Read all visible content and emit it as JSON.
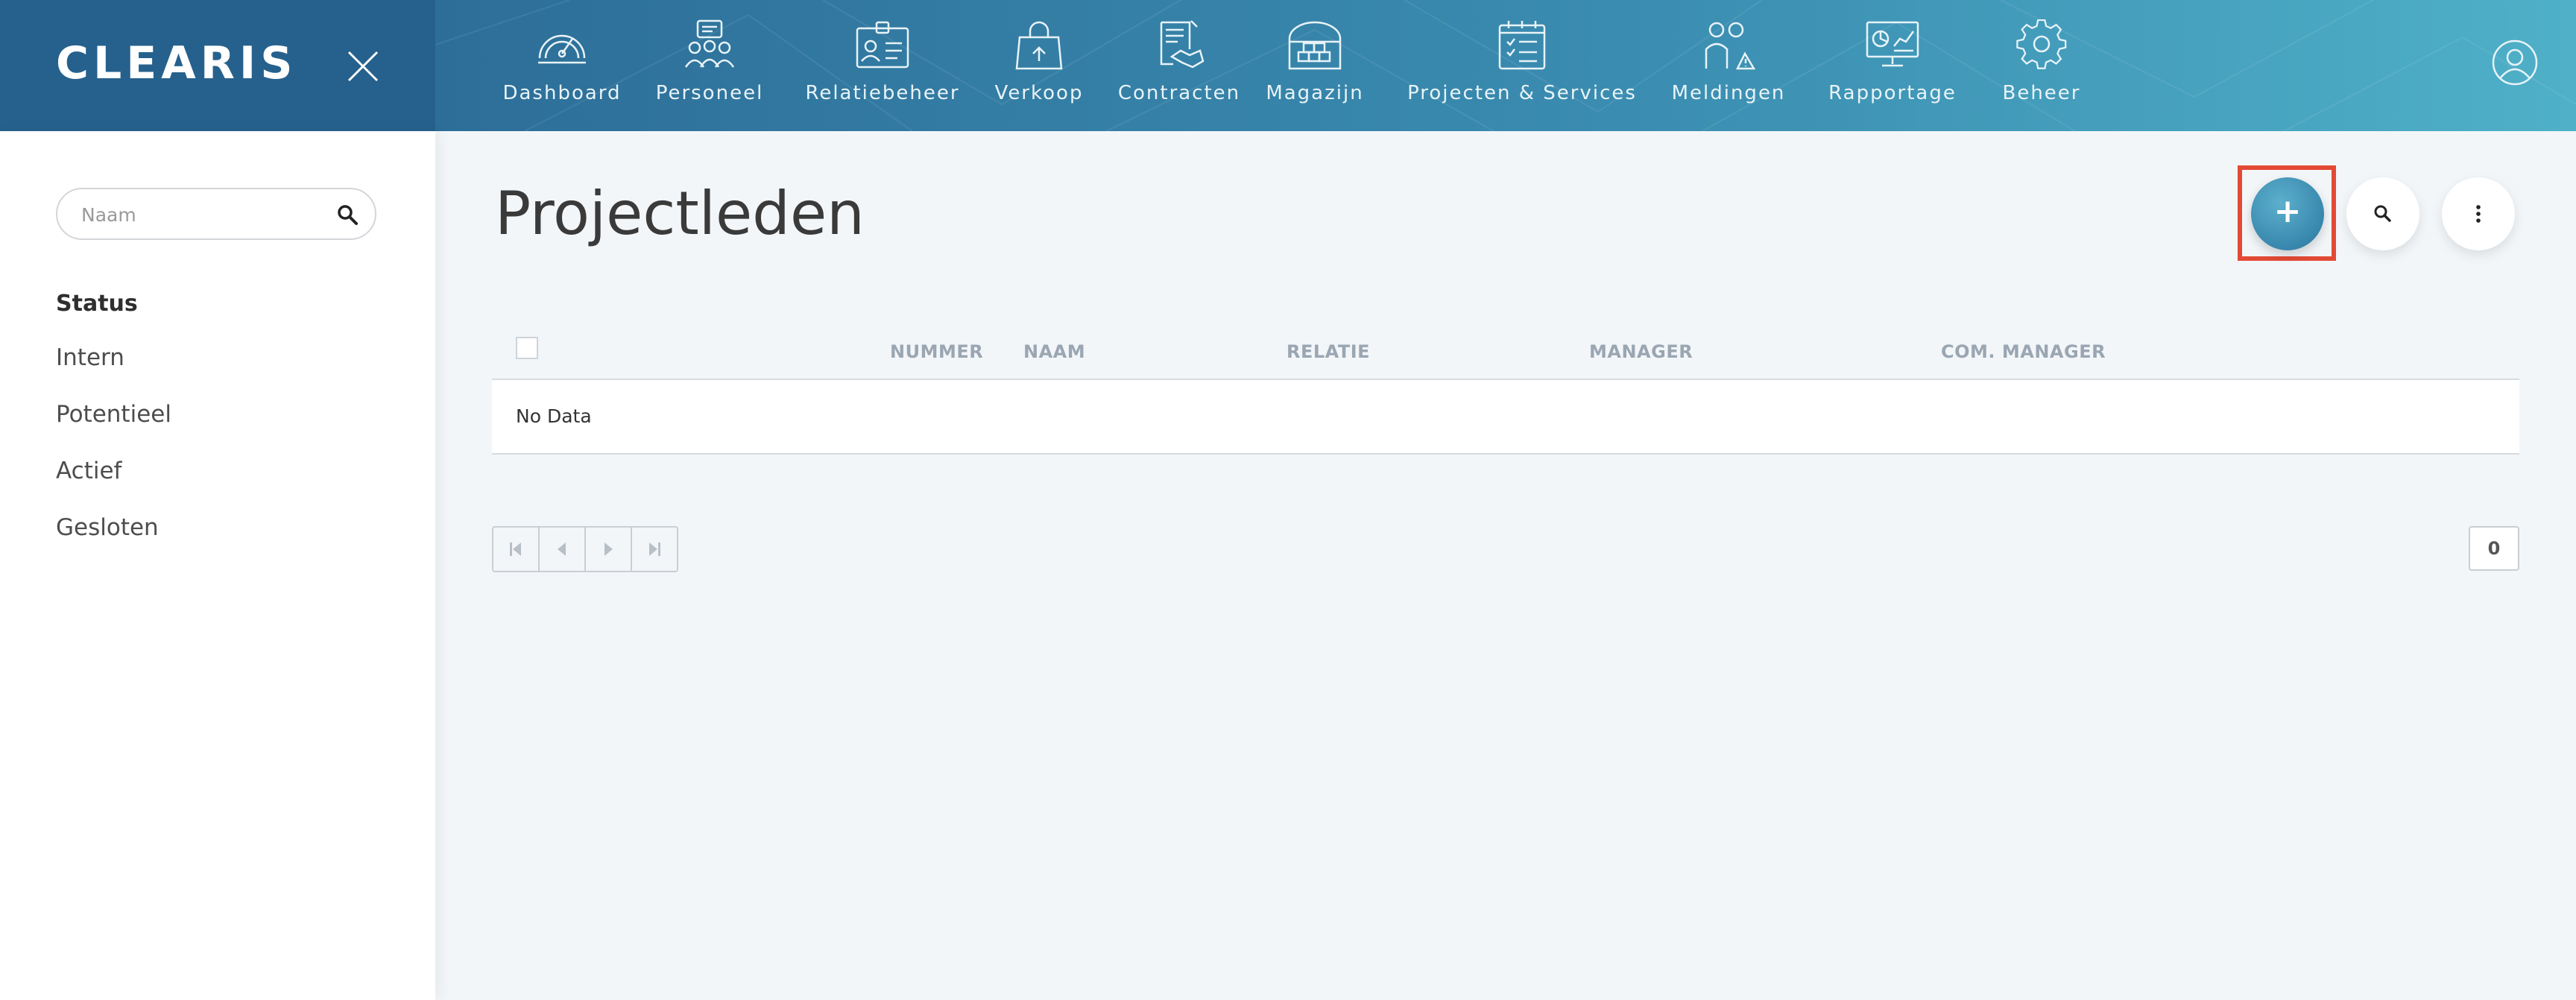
{
  "brand": {
    "name": "CLEARIS"
  },
  "nav": {
    "items": [
      {
        "label": "Dashboard",
        "icon": "speedometer-icon"
      },
      {
        "label": "Personeel",
        "icon": "people-icon"
      },
      {
        "label": "Relatiebeheer",
        "icon": "id-card-icon"
      },
      {
        "label": "Verkoop",
        "icon": "shopping-bag-icon"
      },
      {
        "label": "Contracten",
        "icon": "handshake-contract-icon"
      },
      {
        "label": "Magazijn",
        "icon": "warehouse-icon"
      },
      {
        "label": "Projecten & Services",
        "icon": "calendar-checklist-icon"
      },
      {
        "label": "Meldingen",
        "icon": "person-warning-icon"
      },
      {
        "label": "Rapportage",
        "icon": "monitor-chart-icon"
      },
      {
        "label": "Beheer",
        "icon": "gear-icon"
      }
    ]
  },
  "sidebar": {
    "search_placeholder": "Naam",
    "status_heading": "Status",
    "status_items": [
      "Intern",
      "Potentieel",
      "Actief",
      "Gesloten"
    ]
  },
  "main": {
    "title": "Projectleden",
    "table": {
      "columns": [
        "NUMMER",
        "NAAM",
        "RELATIE",
        "MANAGER",
        "COM. MANAGER"
      ],
      "empty_text": "No Data"
    },
    "pager": {
      "count": "0"
    }
  },
  "colors": {
    "brand_bg": "#26618d",
    "nav_gradient_start": "#2d6e98",
    "nav_gradient_end": "#4fb0c8",
    "accent_button": "#3887ad",
    "highlight": "#e34a35",
    "page_bg": "#f3f6f9"
  }
}
